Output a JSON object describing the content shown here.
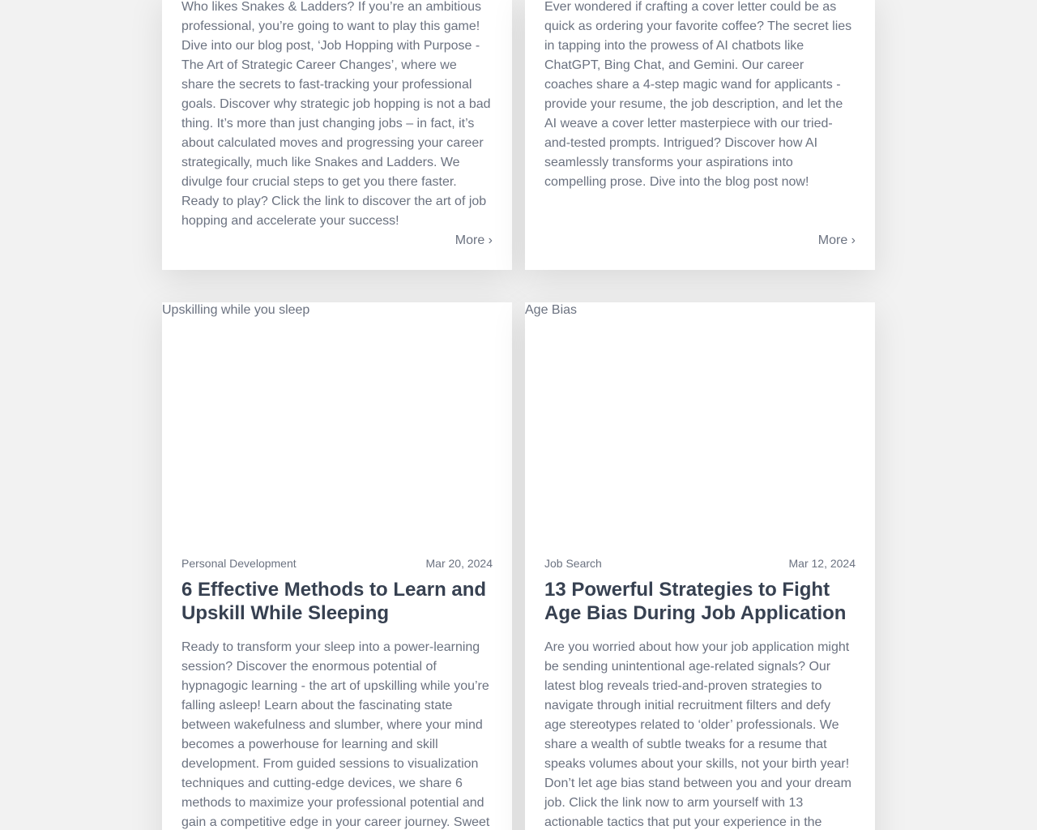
{
  "cards_top": [
    {
      "excerpt": "Who likes Snakes & Ladders? If you’re an ambitious professional, you’re going to want to play this game! Dive into our blog post, ‘Job Hopping with Purpose - The Art of Strategic Career Changes’, where we share the secrets to fast-tracking your professional goals. Discover why strategic job hopping is not a bad thing. It’s more than just changing jobs – in fact, it’s about calculated moves and progressing your career strategically, much like Snakes and Ladders. We divulge four crucial steps to get you there faster. Ready to play? Click the link to discover the art of job hopping and accelerate your success!",
      "more_label": "More ›"
    },
    {
      "excerpt": "Ever wondered if crafting a cover letter could be as quick as ordering your favorite coffee? The secret lies in tapping into the prowess of AI chatbots like ChatGPT, Bing Chat, and Gemini. Our career coaches share a 4-step magic wand for applicants - provide your resume, the job description, and let the AI weave a cover letter masterpiece with our tried-and-tested prompts. Intrigued? Discover how AI seamlessly transforms your aspirations into compelling prose. Dive into the blog post now!",
      "more_label": "More ›"
    }
  ],
  "cards_bottom": [
    {
      "image_alt": "Upskilling while you sleep",
      "category": "Personal Development",
      "date": "Mar 20, 2024",
      "title": "6 Effective Methods to Learn and Upskill While Sleeping",
      "excerpt": "Ready to transform your sleep into a power-learning session? Discover the enormous potential of hypnagogic learning - the art of upskilling while you’re falling asleep! Learn about the fascinating state between wakefulness and slumber, where your mind becomes a powerhouse for learning and skill development. From guided sessions to visualization techniques and cutting-edge devices, we share 6 methods to maximize your professional potential and gain a competitive edge in your career journey. Sweet"
    },
    {
      "image_alt": "Age Bias",
      "category": "Job Search",
      "date": "Mar 12, 2024",
      "title": "13 Powerful Strategies to Fight Age Bias During Job Application",
      "excerpt": "Are you worried about how your job application might be sending unintentional age-related signals? Our latest blog reveals tried-and-proven strategies to navigate through initial recruitment filters and defy age stereotypes related to ‘older’ professionals. We share a wealth of subtle tweaks for a resume that speaks volumes about your skills, not your birth year! Don’t let age bias stand between you and your dream job. Click the link now to arm yourself with 13 actionable tactics that put your experience in the"
    }
  ]
}
